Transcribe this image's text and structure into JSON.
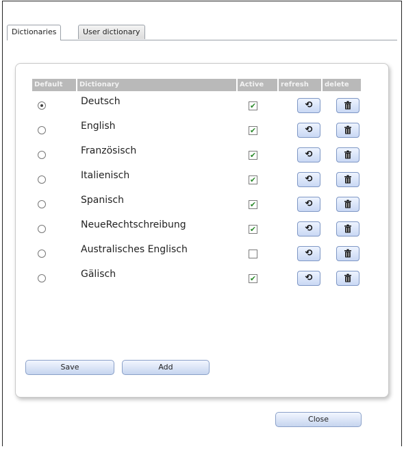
{
  "tabs": [
    {
      "label": "Dictionaries",
      "active": true
    },
    {
      "label": "User dictionary",
      "active": false
    }
  ],
  "table": {
    "headers": {
      "default": "Default",
      "dictionary": "Dictionary",
      "active": "Active",
      "refresh": "refresh",
      "delete": "delete"
    },
    "rows": [
      {
        "name": "Deutsch",
        "default": true,
        "active": true
      },
      {
        "name": "English",
        "default": false,
        "active": true
      },
      {
        "name": "Französisch",
        "default": false,
        "active": true
      },
      {
        "name": "Italienisch",
        "default": false,
        "active": true
      },
      {
        "name": "Spanisch",
        "default": false,
        "active": true
      },
      {
        "name": "NeueRechtschreibung",
        "default": false,
        "active": true
      },
      {
        "name": "Australisches Englisch",
        "default": false,
        "active": false
      },
      {
        "name": "Gälisch",
        "default": false,
        "active": true
      }
    ]
  },
  "icons": {
    "refresh": "refresh-icon",
    "delete": "trash-icon",
    "check": "checkmark-icon"
  },
  "buttons": {
    "save": "Save",
    "add": "Add",
    "close": "Close"
  },
  "colors": {
    "header_bg": "#b9b9b9",
    "header_text": "#f2f2f2",
    "check": "#2e8b2e",
    "button_bg": "#c6d5ef"
  }
}
